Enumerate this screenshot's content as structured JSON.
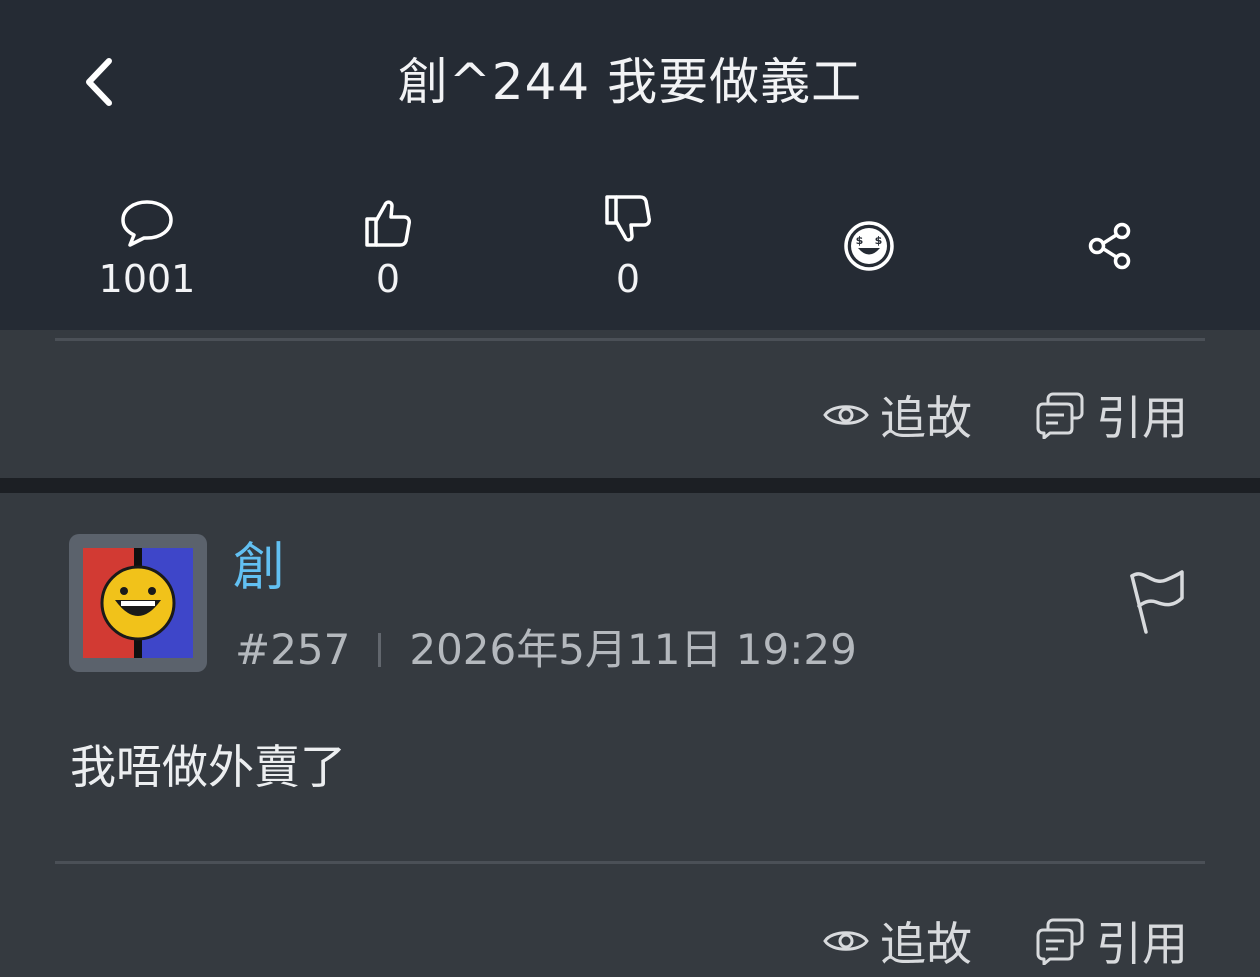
{
  "header": {
    "title": "創^244 我要做義工",
    "stats": {
      "comments": "1001",
      "likes": "0",
      "dislikes": "0"
    }
  },
  "post_previous": {
    "actions": {
      "follow_label": "追故",
      "quote_label": "引用"
    }
  },
  "post": {
    "username": "創",
    "floor": "#257",
    "timestamp": "2026年5月11日 19:29",
    "content": "我唔做外賣了",
    "actions": {
      "follow_label": "追故",
      "quote_label": "引用"
    }
  },
  "colors": {
    "header_bg": "#252b34",
    "card_bg": "#353a40",
    "username": "#62c0f2"
  }
}
